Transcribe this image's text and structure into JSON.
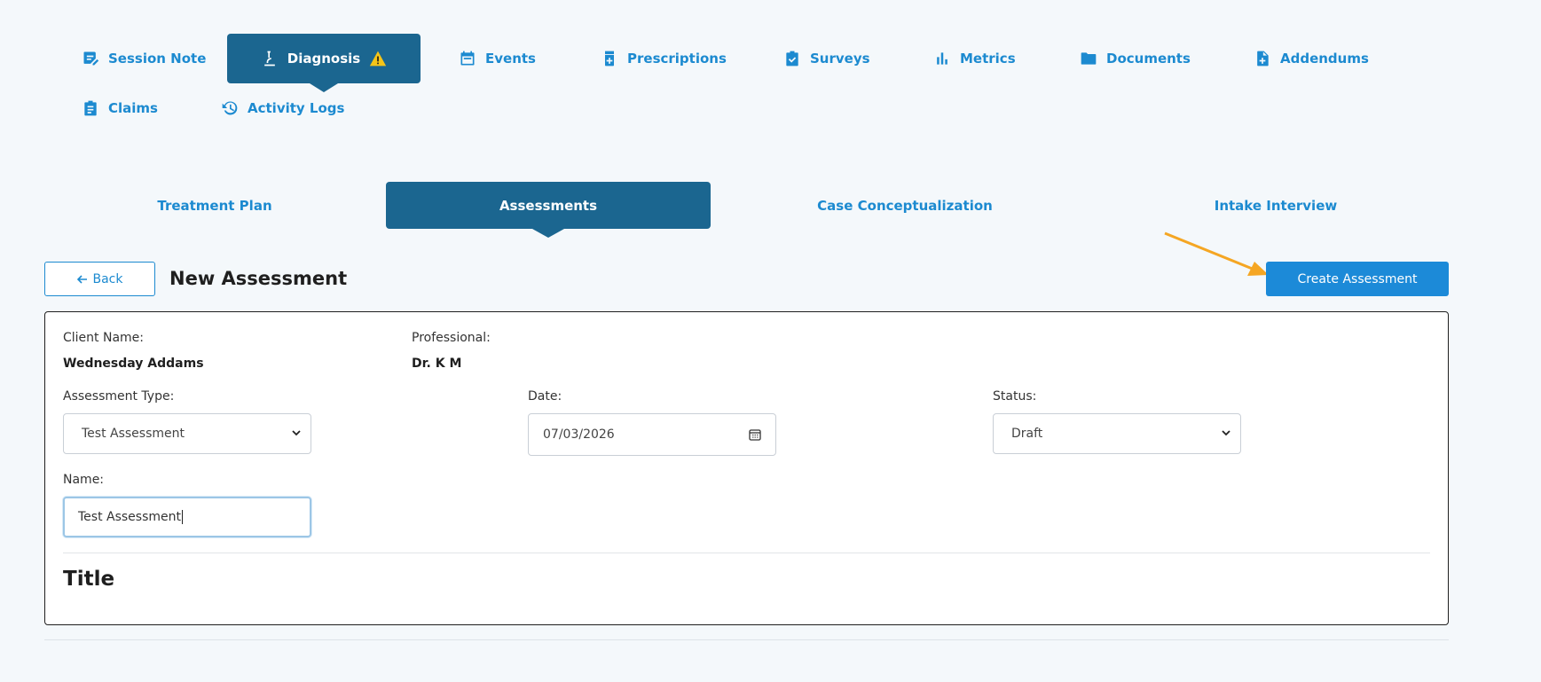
{
  "main_tabs": [
    {
      "label": "Session Note",
      "icon": "note-edit-icon"
    },
    {
      "label": "Diagnosis",
      "icon": "microscope-icon",
      "active": true,
      "warning_icon": "warning-icon"
    },
    {
      "label": "Events",
      "icon": "calendar-icon"
    },
    {
      "label": "Prescriptions",
      "icon": "medicine-bottle-icon"
    },
    {
      "label": "Surveys",
      "icon": "clipboard-check-icon"
    },
    {
      "label": "Metrics",
      "icon": "bar-chart-icon"
    },
    {
      "label": "Documents",
      "icon": "folder-icon"
    },
    {
      "label": "Addendums",
      "icon": "file-plus-icon"
    },
    {
      "label": "Claims",
      "icon": "clipboard-list-icon"
    },
    {
      "label": "Activity Logs",
      "icon": "history-icon"
    }
  ],
  "sub_tabs": [
    {
      "label": "Treatment Plan"
    },
    {
      "label": "Assessments",
      "active": true
    },
    {
      "label": "Case Conceptualization"
    },
    {
      "label": "Intake Interview"
    }
  ],
  "toolbar": {
    "back_label": "Back",
    "page_title": "New Assessment",
    "create_label": "Create Assessment"
  },
  "form": {
    "client_name_label": "Client Name:",
    "client_name": "Wednesday Addams",
    "professional_label": "Professional:",
    "professional": "Dr. K M",
    "assessment_type_label": "Assessment Type:",
    "assessment_type_value": "Test Assessment",
    "date_label": "Date:",
    "date_value": "07/03/2026",
    "status_label": "Status:",
    "status_value": "Draft",
    "name_label": "Name:",
    "name_value": "Test Assessment",
    "section_title": "Title"
  },
  "colors": {
    "accent": "#1c8ad0",
    "active_tab": "#1b6690",
    "annotation_arrow": "#f5a623",
    "warning": "#f5c518"
  }
}
